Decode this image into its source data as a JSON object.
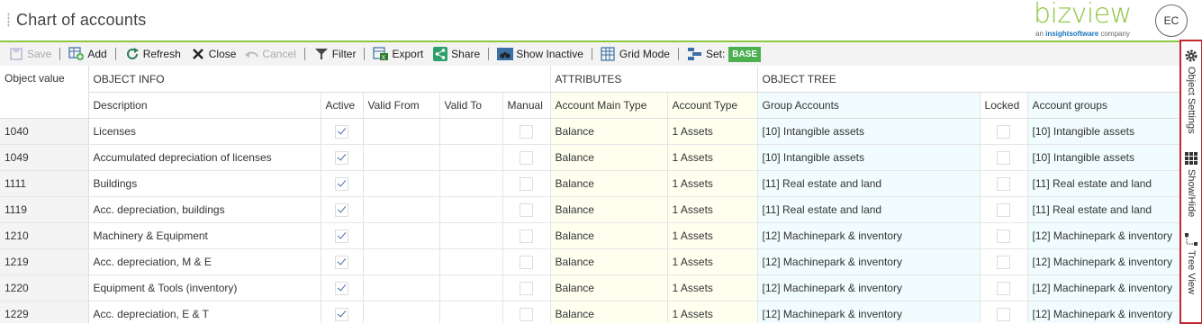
{
  "header": {
    "title": "Chart of accounts",
    "logo_word": "bizview",
    "logo_sub_pre": "an ",
    "logo_sub_brand": "insightsoftware",
    "logo_sub_post": " company",
    "avatar": "EC"
  },
  "toolbar": {
    "save": "Save",
    "add": "Add",
    "refresh": "Refresh",
    "close": "Close",
    "cancel": "Cancel",
    "filter": "Filter",
    "export": "Export",
    "share": "Share",
    "show_inactive": "Show Inactive",
    "grid_mode": "Grid Mode",
    "set_label": "Set:",
    "set_value": "BASE"
  },
  "columns": {
    "groups": {
      "object_value": "Object value",
      "object_info": "OBJECT INFO",
      "attributes": "ATTRIBUTES",
      "object_tree": "OBJECT TREE"
    },
    "description": "Description",
    "active": "Active",
    "valid_from": "Valid From",
    "valid_to": "Valid To",
    "manual": "Manual",
    "account_main_type": "Account Main Type",
    "account_type": "Account Type",
    "group_accounts": "Group Accounts",
    "locked": "Locked",
    "account_groups": "Account groups"
  },
  "rows": [
    {
      "object_value": "1040",
      "description": "Licenses",
      "active": true,
      "manual": false,
      "main_type": "Balance",
      "type": "1 Assets",
      "group": "[10] Intangible assets",
      "locked": false,
      "acc_group": "[10] Intangible assets"
    },
    {
      "object_value": "1049",
      "description": "Accumulated depreciation of licenses",
      "active": true,
      "manual": false,
      "main_type": "Balance",
      "type": "1 Assets",
      "group": "[10] Intangible assets",
      "locked": false,
      "acc_group": "[10] Intangible assets"
    },
    {
      "object_value": "1111",
      "description": "Buildings",
      "active": true,
      "manual": false,
      "main_type": "Balance",
      "type": "1 Assets",
      "group": "[11] Real estate and land",
      "locked": false,
      "acc_group": "[11] Real estate and land"
    },
    {
      "object_value": "1119",
      "description": "Acc. depreciation, buildings",
      "active": true,
      "manual": false,
      "main_type": "Balance",
      "type": "1 Assets",
      "group": "[11] Real estate and land",
      "locked": false,
      "acc_group": "[11] Real estate and land"
    },
    {
      "object_value": "1210",
      "description": "Machinery & Equipment",
      "active": true,
      "manual": false,
      "main_type": "Balance",
      "type": "1 Assets",
      "group": "[12] Machinepark & inventory",
      "locked": false,
      "acc_group": "[12] Machinepark & inventory"
    },
    {
      "object_value": "1219",
      "description": "Acc. depreciation, M & E",
      "active": true,
      "manual": false,
      "main_type": "Balance",
      "type": "1 Assets",
      "group": "[12] Machinepark & inventory",
      "locked": false,
      "acc_group": "[12] Machinepark & inventory"
    },
    {
      "object_value": "1220",
      "description": "Equipment & Tools (inventory)",
      "active": true,
      "manual": false,
      "main_type": "Balance",
      "type": "1 Assets",
      "group": "[12] Machinepark & inventory",
      "locked": false,
      "acc_group": "[12] Machinepark & inventory"
    },
    {
      "object_value": "1229",
      "description": "Acc. depreciation, E & T",
      "active": true,
      "manual": false,
      "main_type": "Balance",
      "type": "1 Assets",
      "group": "[12] Machinepark & inventory",
      "locked": false,
      "acc_group": "[12] Machinepark & inventory"
    }
  ],
  "right_panel": {
    "object_settings": "Object Settings",
    "show_hide": "Show/Hide",
    "tree_view": "Tree View"
  },
  "colors": {
    "brand_green": "#8dc63f",
    "panel_border": "#c0282f",
    "attr_bg": "#fffff0",
    "tree_bg": "#f0fcfd"
  },
  "icons": {
    "save": "save-icon",
    "add": "add-icon",
    "refresh": "refresh-icon",
    "close": "close-icon",
    "cancel": "undo-icon",
    "filter": "funnel-icon",
    "export": "excel-export-icon",
    "share": "share-icon",
    "show_inactive": "binoculars-icon",
    "grid_mode": "grid-icon",
    "set": "set-icon",
    "object_settings": "gear-icon",
    "show_hide": "grid-squares-icon",
    "tree_view": "tree-icon"
  }
}
